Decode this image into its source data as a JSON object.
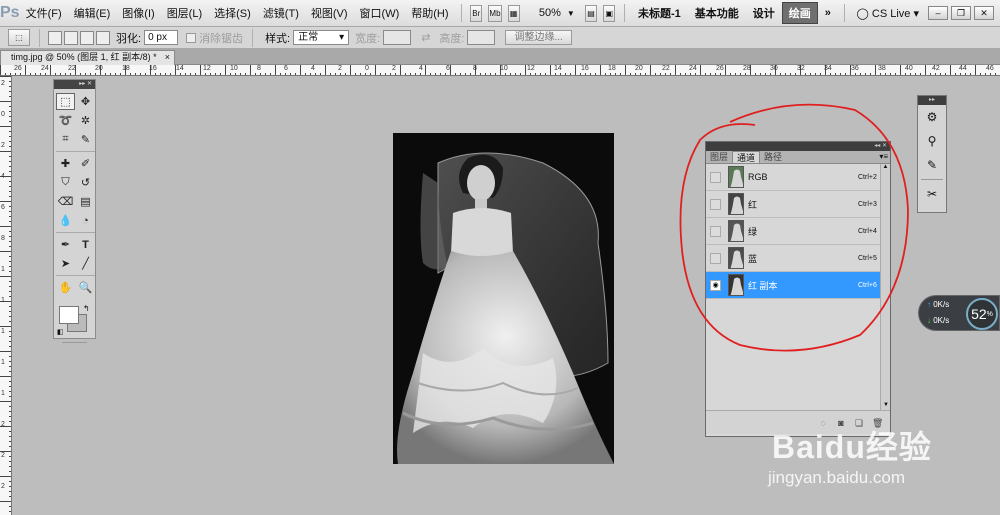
{
  "app": {
    "logo": "Ps"
  },
  "menu": [
    "文件(F)",
    "编辑(E)",
    "图像(I)",
    "图层(L)",
    "选择(S)",
    "滤镜(T)",
    "视图(V)",
    "窗口(W)",
    "帮助(H)"
  ],
  "menubar": {
    "zoom": "50%",
    "workspaces": [
      "未标题-1",
      "基本功能",
      "设计",
      "绘画"
    ],
    "active_workspace": "绘画",
    "more": "»",
    "cs_live": "CS Live"
  },
  "options": {
    "feather_label": "羽化:",
    "feather_value": "0 px",
    "antialias_label": "消除锯齿",
    "style_label": "样式:",
    "style_value": "正常",
    "width_label": "宽度:",
    "height_label": "高度:",
    "refine_edge": "调整边缘..."
  },
  "document": {
    "tab_title": "timg.jpg @ 50% (图层 1, 红 副本/8) *",
    "close": "×"
  },
  "ruler_top_labels": [
    "26",
    "24",
    "22",
    "20",
    "18",
    "16",
    "14",
    "12",
    "10",
    "8",
    "6",
    "4",
    "2",
    "0",
    "2",
    "4",
    "6",
    "8",
    "10",
    "12",
    "14",
    "16",
    "18",
    "20",
    "22",
    "24",
    "26",
    "28",
    "30",
    "32",
    "34",
    "36",
    "38",
    "40",
    "42",
    "44",
    "46"
  ],
  "ruler_left_labels": [
    "2",
    "0",
    "2",
    "4",
    "6",
    "8",
    "1",
    "1",
    "1",
    "1",
    "1",
    "2",
    "2",
    "2"
  ],
  "channels_panel": {
    "tabs": [
      "图层",
      "通道",
      "路径"
    ],
    "active_tab": "通道",
    "rows": [
      {
        "name": "RGB",
        "shortcut": "Ctrl+2",
        "visible": false,
        "selected": false,
        "thumb_color": "#5a7a55"
      },
      {
        "name": "红",
        "shortcut": "Ctrl+3",
        "visible": false,
        "selected": false,
        "thumb_color": "#444444"
      },
      {
        "name": "绿",
        "shortcut": "Ctrl+4",
        "visible": false,
        "selected": false,
        "thumb_color": "#555555"
      },
      {
        "name": "蓝",
        "shortcut": "Ctrl+5",
        "visible": false,
        "selected": false,
        "thumb_color": "#4d4d4d"
      },
      {
        "name": "红 副本",
        "shortcut": "Ctrl+6",
        "visible": true,
        "selected": true,
        "thumb_color": "#333333"
      }
    ]
  },
  "network_widget": {
    "upload": "0K/s",
    "download": "0K/s",
    "percent": "52",
    "percent_unit": "%"
  },
  "watermark": {
    "logo": "Baidu经验",
    "url": "jingyan.baidu.com"
  },
  "colors": {
    "selection": "#3399ff",
    "annotation": "#e02020"
  }
}
